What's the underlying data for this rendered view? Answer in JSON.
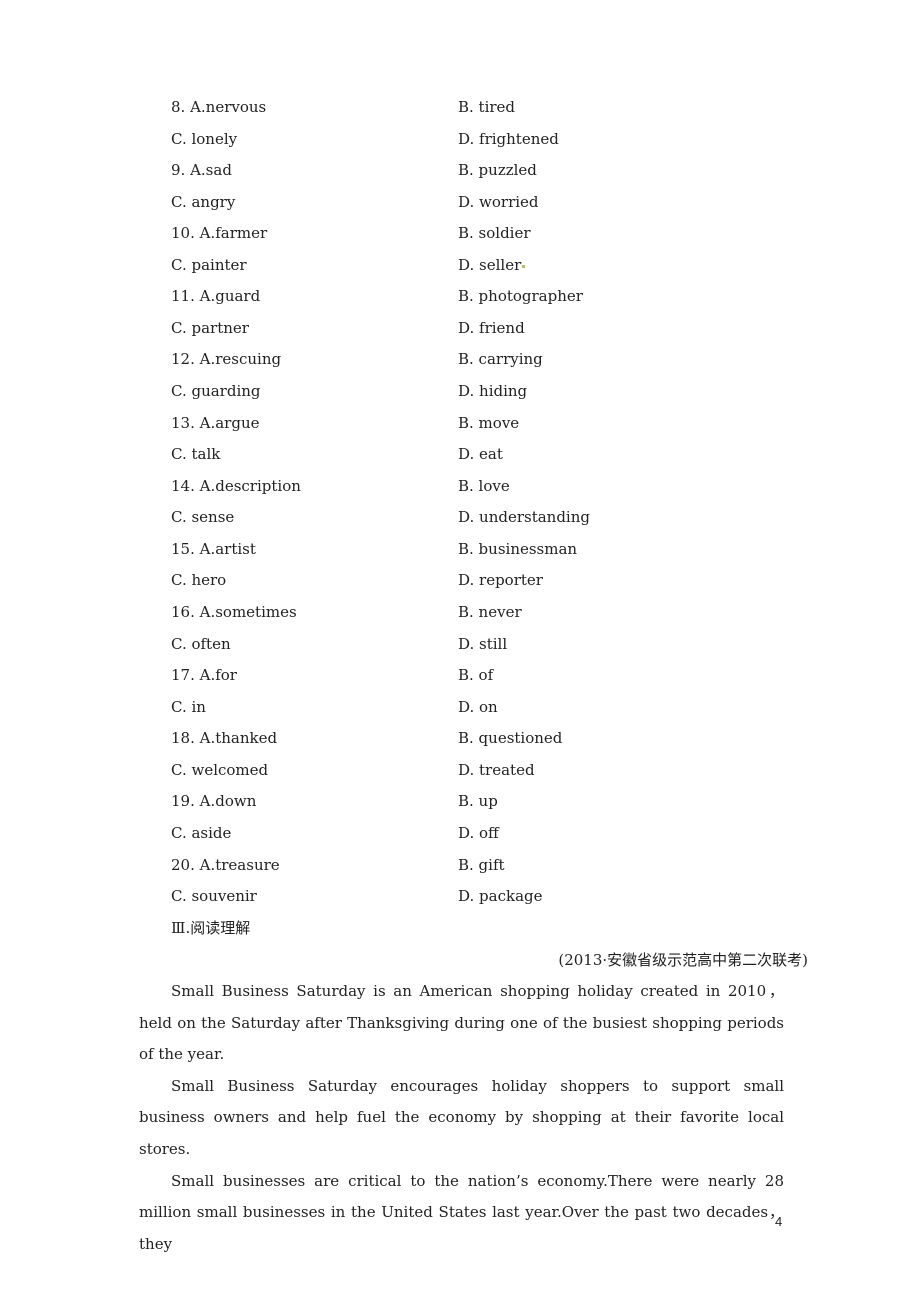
{
  "questions": [
    {
      "a": "8. A.nervous",
      "b": "B. tired",
      "c": "C. lonely",
      "d": "D. frightened"
    },
    {
      "a": "9. A.sad",
      "b": "B. puzzled",
      "c": "C. angry",
      "d": "D. worried"
    },
    {
      "a": "10. A.farmer",
      "b": "B. soldier",
      "c": "C. painter",
      "d": "D. seller"
    },
    {
      "a": "11. A.guard",
      "b": "B. photographer",
      "c": "C. partner",
      "d": "D. friend"
    },
    {
      "a": "12. A.rescuing",
      "b": "B. carrying",
      "c": "C. guarding",
      "d": "D. hiding"
    },
    {
      "a": "13. A.argue",
      "b": "B. move",
      "c": "C. talk",
      "d": "D. eat"
    },
    {
      "a": "14. A.description",
      "b": "B. love",
      "c": "C. sense",
      "d": "D. understanding"
    },
    {
      "a": "15. A.artist",
      "b": "B. businessman",
      "c": "C. hero",
      "d": "D. reporter"
    },
    {
      "a": "16. A.sometimes",
      "b": "B. never",
      "c": "C. often",
      "d": "D. still"
    },
    {
      "a": "17. A.for",
      "b": "B. of",
      "c": "C. in",
      "d": "D. on"
    },
    {
      "a": "18. A.thanked",
      "b": "B. questioned",
      "c": "C. welcomed",
      "d": "D. treated"
    },
    {
      "a": "19. A.down",
      "b": "B. up",
      "c": "C. aside",
      "d": "D. off"
    },
    {
      "a": "20. A.treasure",
      "b": "B. gift",
      "c": "C. souvenir",
      "d": "D. package"
    }
  ],
  "section_heading": "Ⅲ.阅读理解",
  "source": "(2013·安徽省级示范高中第二次联考)",
  "passage": [
    "Small Business Saturday is an American shopping holiday created in 2010，held on the Saturday after Thanksgiving during one of the busiest shopping periods of the year.",
    "Small Business Saturday encourages holiday shoppers to support small business owners and help fuel the economy by shopping at their favorite local stores.",
    "Small businesses are critical to the nation’s economy.There were nearly 28 million small businesses in the United States last year.Over the past two decades，they"
  ],
  "page_number": "4"
}
